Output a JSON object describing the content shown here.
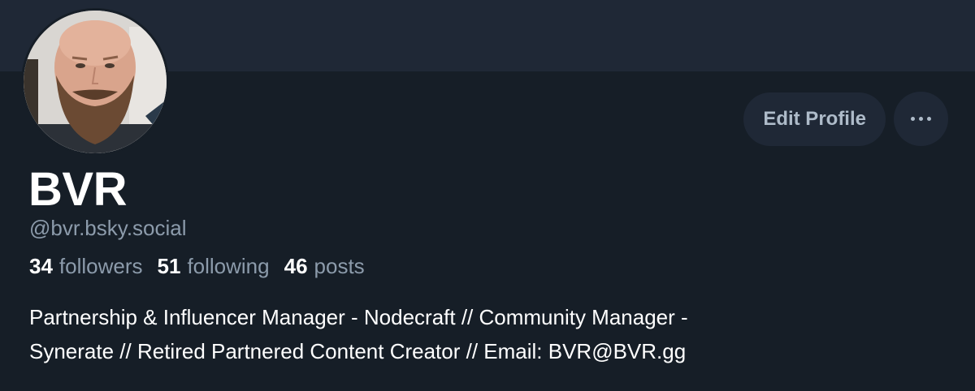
{
  "profile": {
    "display_name": "BVR",
    "handle": "@bvr.bsky.social",
    "stats": {
      "followers_count": "34",
      "followers_label": "followers",
      "following_count": "51",
      "following_label": "following",
      "posts_count": "46",
      "posts_label": "posts"
    },
    "bio_line1": "Partnership & Influencer Manager - Nodecraft // Community Manager -",
    "bio_line2": "Synerate // Retired Partnered Content Creator // Email: BVR@BVR.gg"
  },
  "actions": {
    "edit_label": "Edit Profile",
    "more_icon": "ellipsis-icon"
  },
  "colors": {
    "background": "#161e27",
    "banner": "#1f2836",
    "button_bg": "#1f2836",
    "muted_text": "#8c9bab",
    "primary_text": "#ffffff"
  }
}
